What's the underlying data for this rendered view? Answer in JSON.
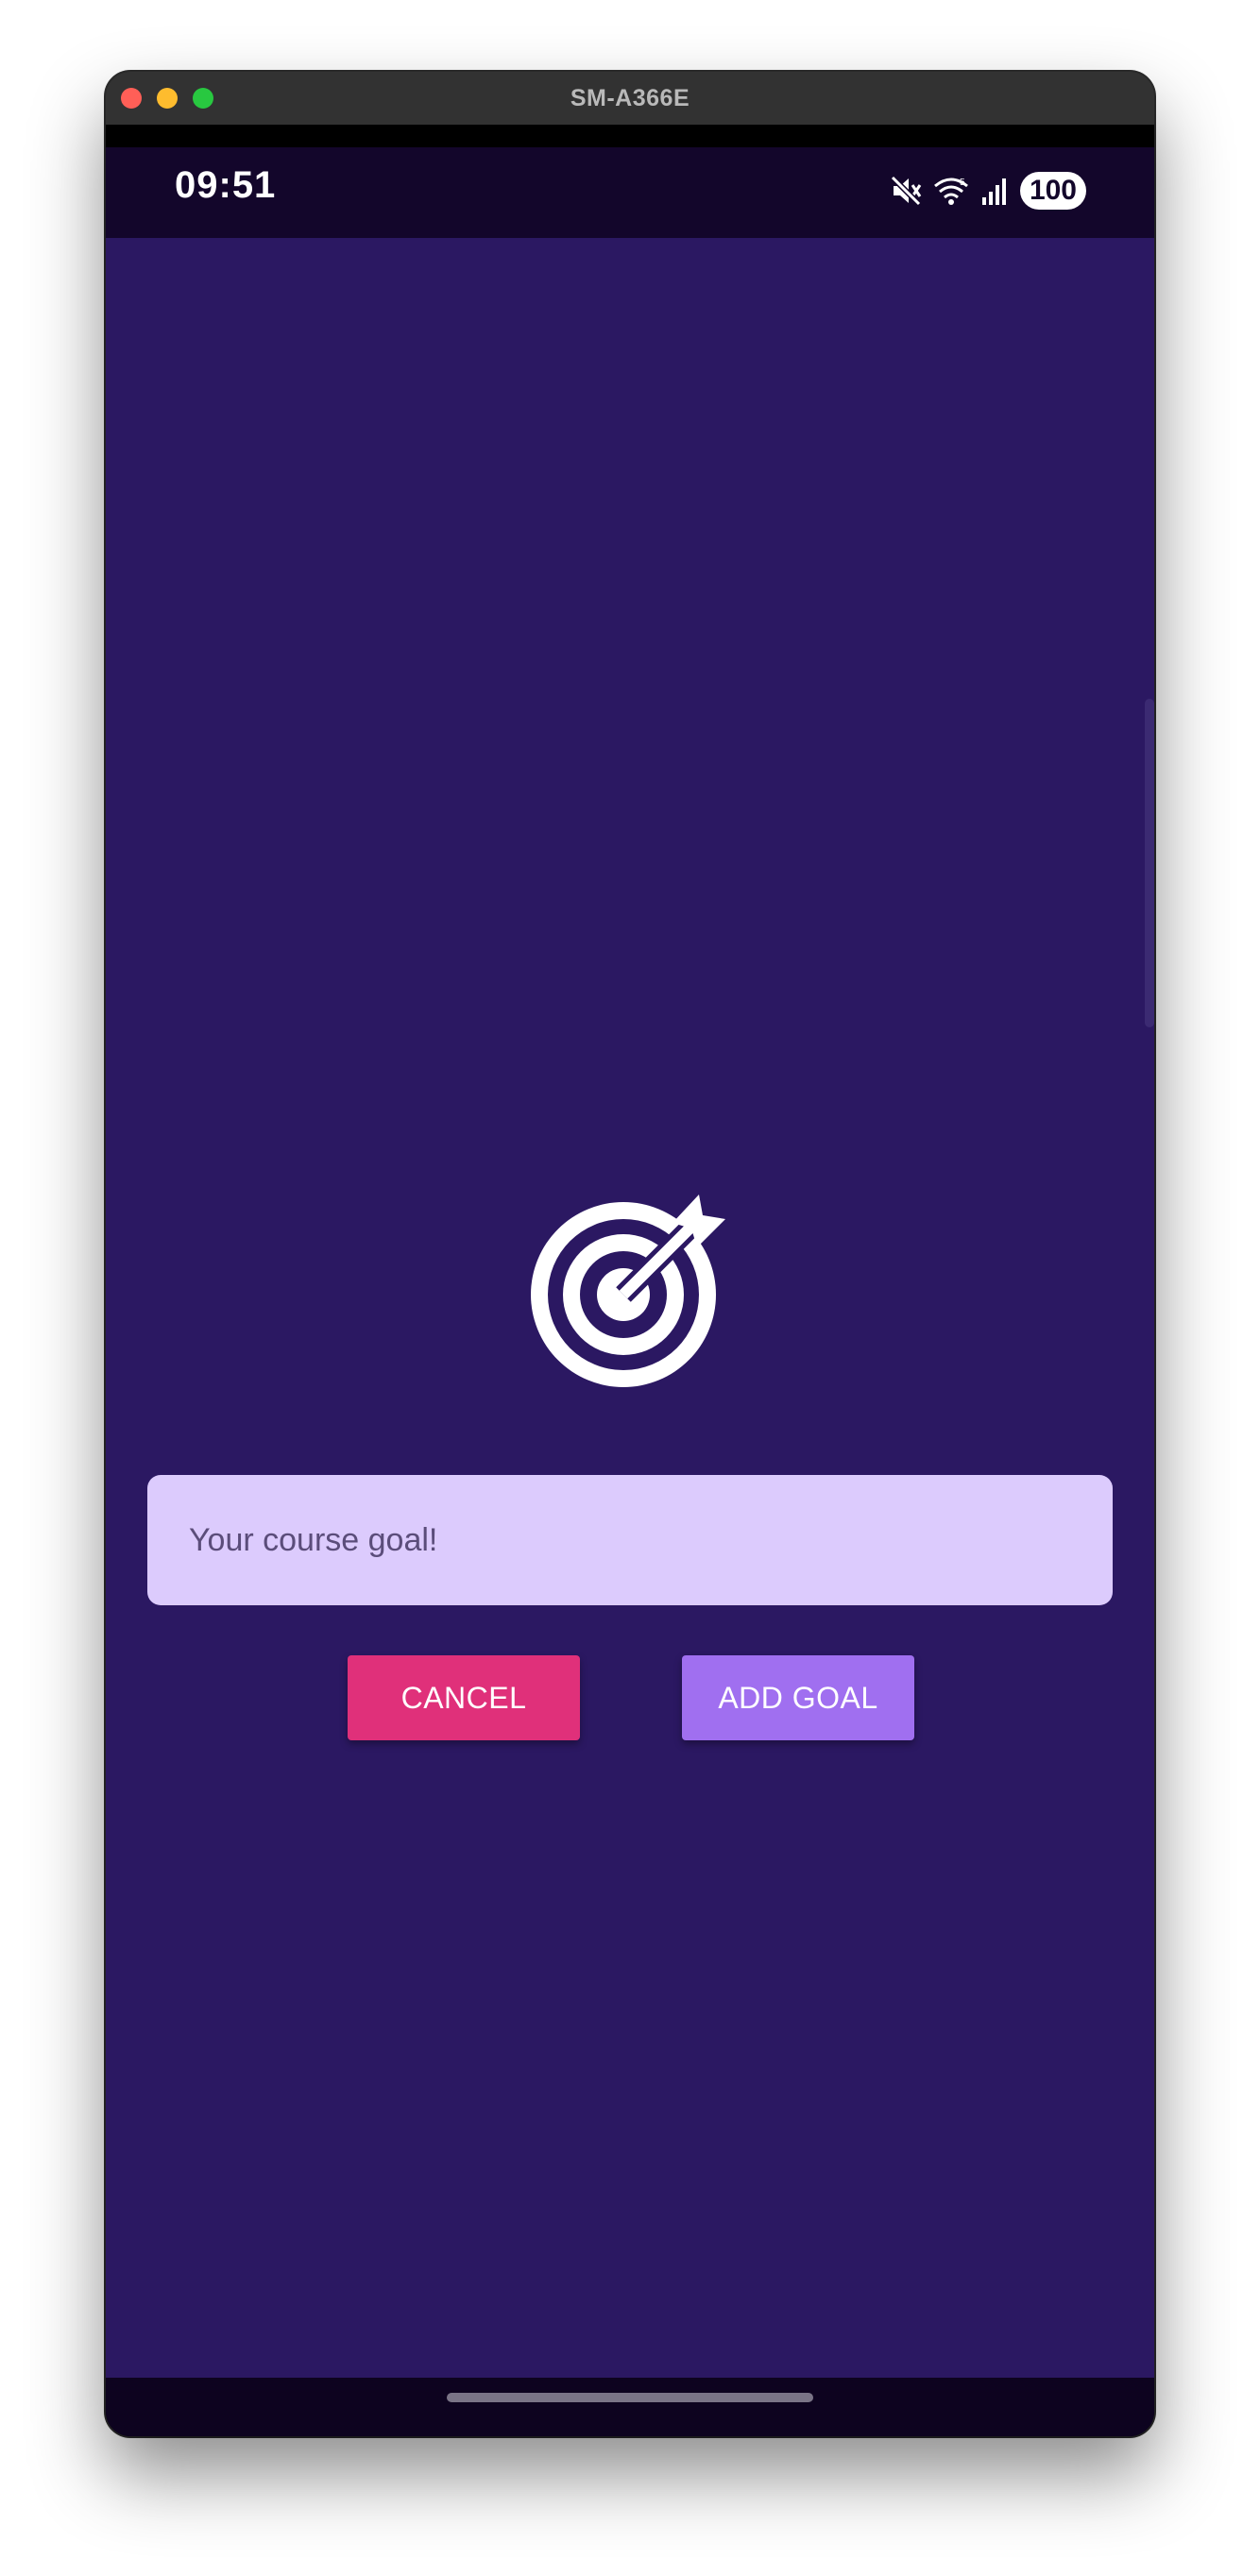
{
  "window": {
    "title": "SM-A366E"
  },
  "status_bar": {
    "time": "09:51",
    "battery": "100",
    "icons": [
      "mute-icon",
      "wifi-icon",
      "signal-icon"
    ]
  },
  "goal_form": {
    "icon": "target-arrow-icon",
    "input_placeholder": "Your course goal!",
    "input_value": "",
    "cancel_label": "CANCEL",
    "add_label": "ADD GOAL"
  },
  "colors": {
    "background": "#2b1862",
    "input_background": "#dccbfd",
    "cancel": "#e0307a",
    "add": "#a06ff0"
  }
}
